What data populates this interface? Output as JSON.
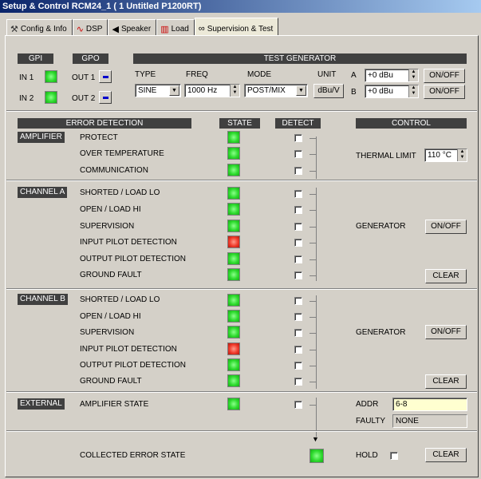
{
  "window": {
    "title": "Setup & Control RCM24_1 ( 1 Untitled P1200RT)"
  },
  "tabs": [
    {
      "label": "Config & Info",
      "icon": "wrench-icon"
    },
    {
      "label": "DSP",
      "icon": "curve-icon"
    },
    {
      "label": "Speaker",
      "icon": "speaker-icon"
    },
    {
      "label": "Load",
      "icon": "load-icon"
    },
    {
      "label": "Supervision & Test",
      "icon": "glasses-icon",
      "active": true
    }
  ],
  "gpi": {
    "header": "GPI",
    "in1": "IN 1",
    "in2": "IN 2"
  },
  "gpo": {
    "header": "GPO",
    "out1": "OUT 1",
    "out2": "OUT 2"
  },
  "test_generator": {
    "header": "TEST GENERATOR",
    "type_label": "TYPE",
    "type_value": "SINE",
    "freq_label": "FREQ",
    "freq_value": "1000 Hz",
    "mode_label": "MODE",
    "mode_value": "POST/MIX",
    "unit_label": "UNIT",
    "unit_button": "dBu/V",
    "a_label": "A",
    "a_value": "+0 dBu",
    "a_button": "ON/OFF",
    "b_label": "B",
    "b_value": "+0 dBu",
    "b_button": "ON/OFF"
  },
  "headers": {
    "error_detection": "ERROR DETECTION",
    "state": "STATE",
    "detect": "DETECT",
    "control": "CONTROL"
  },
  "amplifier": {
    "label": "AMPLIFIER",
    "rows": [
      "PROTECT",
      "OVER TEMPERATURE",
      "COMMUNICATION"
    ],
    "thermal_label": "THERMAL LIMIT",
    "thermal_value": "110 °C"
  },
  "channel_a": {
    "label": "CHANNEL A",
    "rows": [
      "SHORTED / LOAD LO",
      "OPEN / LOAD HI",
      "SUPERVISION",
      "INPUT PILOT DETECTION",
      "OUTPUT PILOT DETECTION",
      "GROUND FAULT"
    ],
    "generator_label": "GENERATOR",
    "generator_button": "ON/OFF",
    "clear_button": "CLEAR"
  },
  "channel_b": {
    "label": "CHANNEL B",
    "rows": [
      "SHORTED / LOAD LO",
      "OPEN / LOAD HI",
      "SUPERVISION",
      "INPUT PILOT DETECTION",
      "OUTPUT PILOT DETECTION",
      "GROUND FAULT"
    ],
    "generator_label": "GENERATOR",
    "generator_button": "ON/OFF",
    "clear_button": "CLEAR"
  },
  "external": {
    "label": "EXTERNAL",
    "row": "AMPLIFIER STATE",
    "addr_label": "ADDR",
    "addr_value": "6-8",
    "faulty_label": "FAULTY",
    "faulty_value": "NONE"
  },
  "collected": {
    "label": "COLLECTED ERROR STATE",
    "hold_label": "HOLD",
    "clear_button": "CLEAR"
  },
  "colors": {
    "led_green": "#2edb2e",
    "led_red": "#f03a2a",
    "header_bg": "#404040",
    "accent_blue": "#0000cc"
  }
}
